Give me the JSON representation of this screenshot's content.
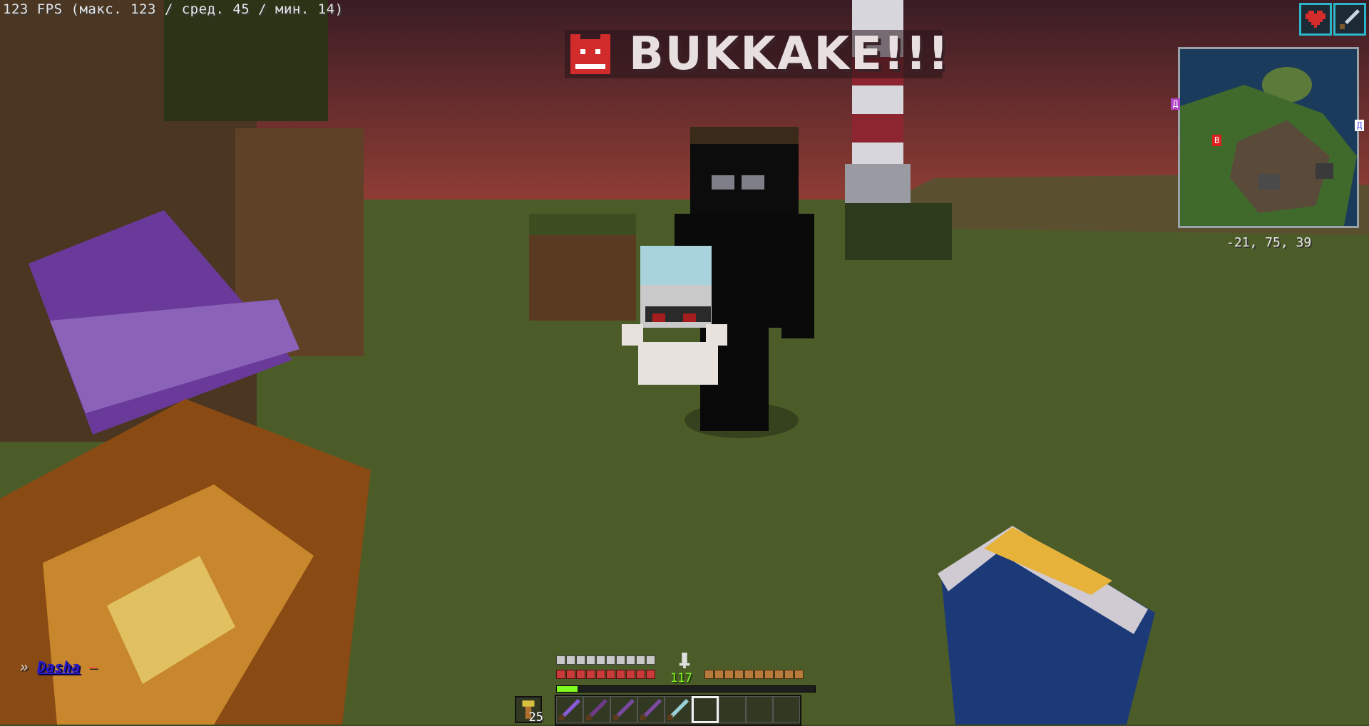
{
  "hud": {
    "fps_text": "123 FPS (макс. 123 / сред. 45 / мин. 14)",
    "title_text": "BUKKAKE!!!",
    "title_icon": "red-creature-icon",
    "coords_text": "-21, 75, 39",
    "xp_level": "117",
    "xp_progress": 0.08,
    "offhand_count": "25",
    "armor_points": 20,
    "health_points": 20,
    "hunger_points": 20
  },
  "effects": [
    {
      "icon": "heart-icon",
      "color": "#d42b2b"
    },
    {
      "icon": "sword-icon",
      "color": "#c9d6e0"
    }
  ],
  "minimap": {
    "labels": [
      {
        "text": "Д",
        "color": "#d845d8"
      },
      {
        "text": "Д",
        "color": "#8c8cff"
      },
      {
        "text": "В",
        "color": "#e02020"
      }
    ]
  },
  "chat": {
    "prefix": "»",
    "name": "Dasha",
    "separator": "–"
  },
  "hotbar": {
    "slots": [
      {
        "item": "netherite-sword-icon",
        "color": "#8a5ad8"
      },
      {
        "item": "netherite-pickaxe-icon",
        "color": "#6e3b8a"
      },
      {
        "item": "netherite-shovel-icon",
        "color": "#7a4aa0"
      },
      {
        "item": "netherite-axe-icon",
        "color": "#7a4aa0"
      },
      {
        "item": "trident-icon",
        "color": "#9ad0d8"
      },
      {
        "item": "empty",
        "color": ""
      },
      {
        "item": "empty",
        "color": ""
      },
      {
        "item": "empty",
        "color": ""
      },
      {
        "item": "empty",
        "color": ""
      }
    ],
    "selected_index": 5
  }
}
